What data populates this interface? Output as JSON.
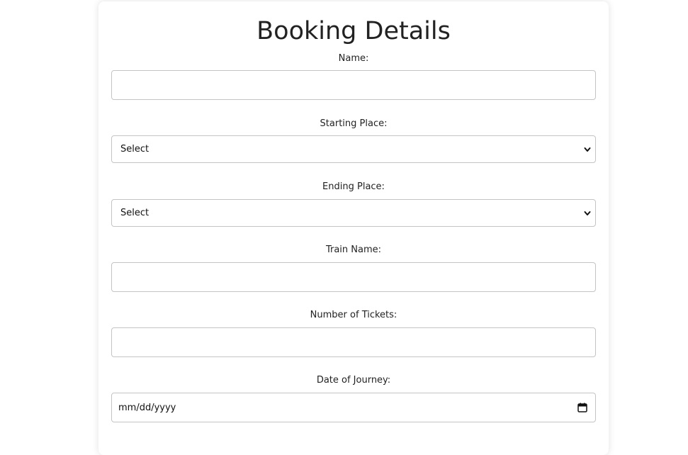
{
  "form": {
    "title": "Booking Details",
    "name": {
      "label": "Name:",
      "value": ""
    },
    "starting_place": {
      "label": "Starting Place:",
      "selected": "Select"
    },
    "ending_place": {
      "label": "Ending Place:",
      "selected": "Select"
    },
    "train_name": {
      "label": "Train Name:",
      "value": ""
    },
    "tickets": {
      "label": "Number of Tickets:",
      "value": ""
    },
    "date": {
      "label": "Date of Journey:",
      "placeholder": "mm/dd/yyyy"
    }
  },
  "icons": {
    "select_chevron": "chevron-down-icon",
    "date_picker": "calendar-icon"
  }
}
